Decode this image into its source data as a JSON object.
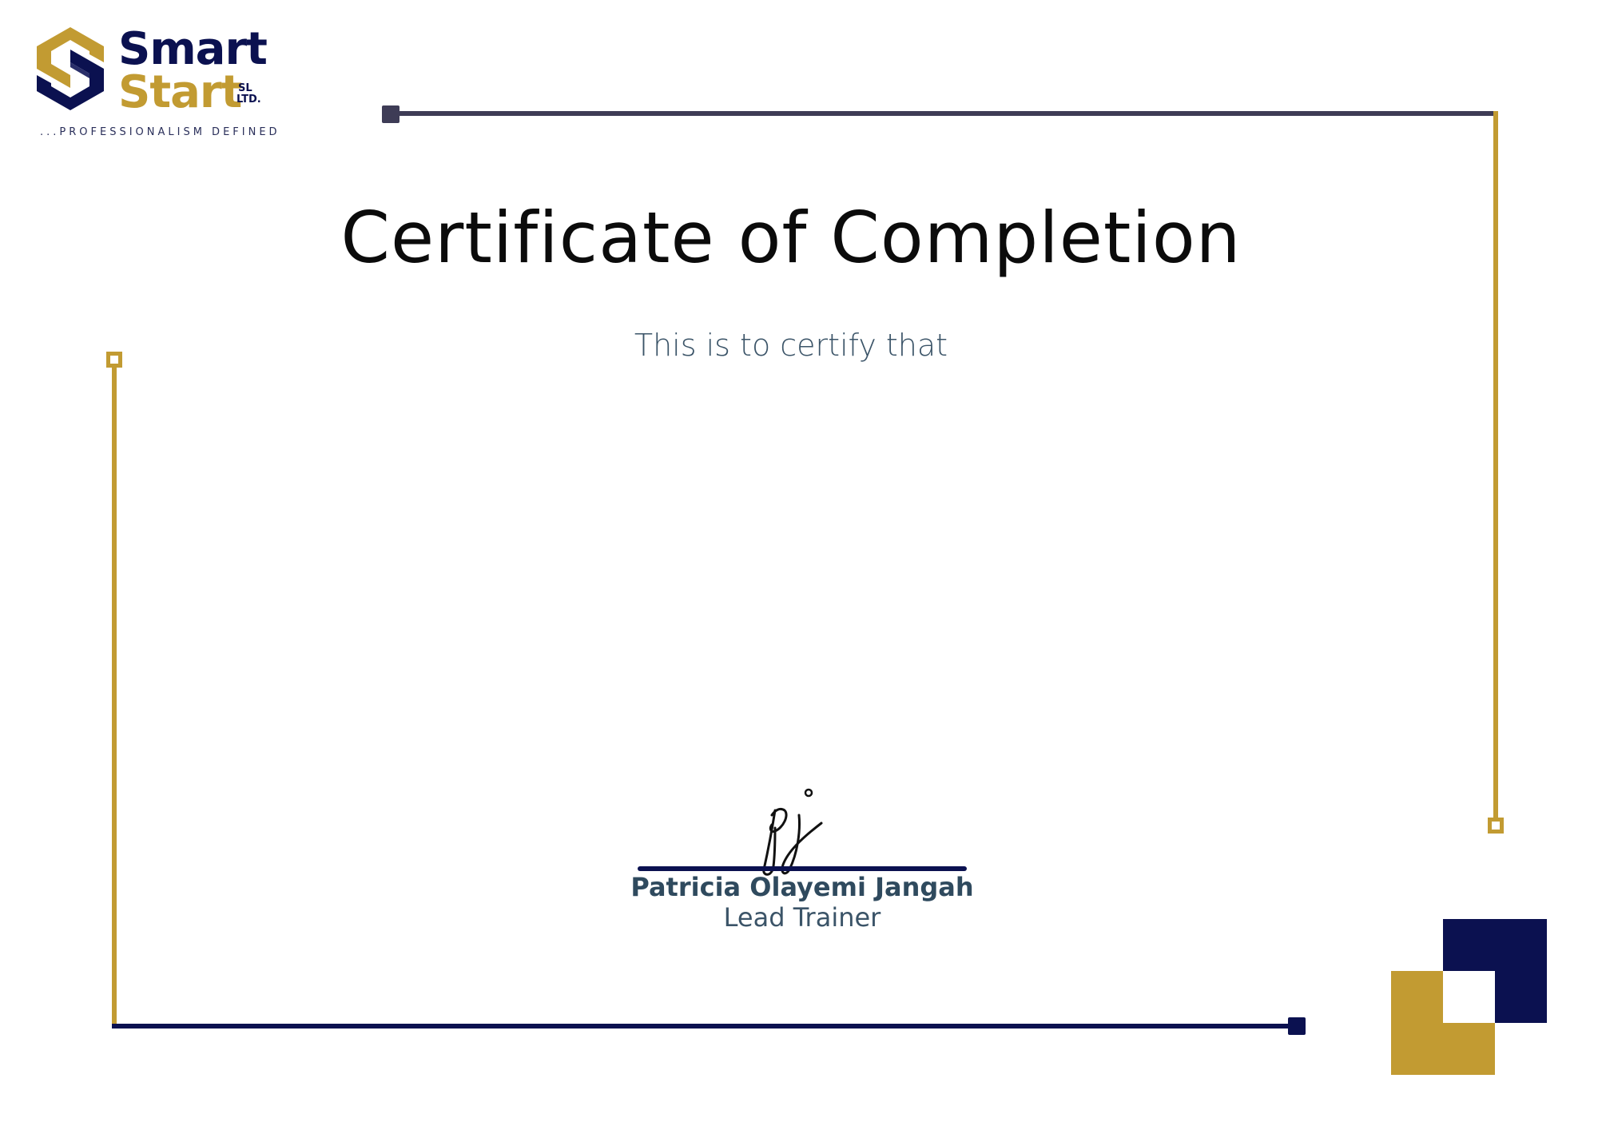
{
  "brand": {
    "name_line1": "Smart",
    "name_line2": "Start",
    "suffix_line1": "SL",
    "suffix_line2": "LTD.",
    "tagline": "...PROFESSIONALISM DEFINED",
    "colors": {
      "navy": "#0b1150",
      "gold": "#c29b32"
    }
  },
  "certificate": {
    "title": "Certificate of Completion",
    "intro": "This is to certify that"
  },
  "signatory": {
    "signature_initials": "pj",
    "name": "Patricia Olayemi Jangah",
    "role": "Lead Trainer"
  }
}
